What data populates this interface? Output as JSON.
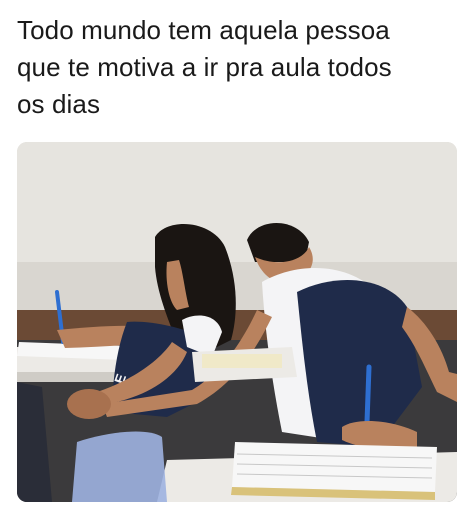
{
  "post": {
    "caption": "Todo mundo tem aquela pessoa\nque te motiva a ir pra aula todos\nos dias"
  },
  "photo": {
    "colors": {
      "wall": "#e6e4df",
      "wall_shadow": "#d4d1cb",
      "wainscot": "#6b4a35",
      "uniform_navy": "#1f2b4a",
      "uniform_white": "#f4f4f6",
      "skin": "#b9825e",
      "hair": "#1a1512",
      "desk": "#eceae6",
      "pen_blue": "#2e6fd1"
    }
  }
}
